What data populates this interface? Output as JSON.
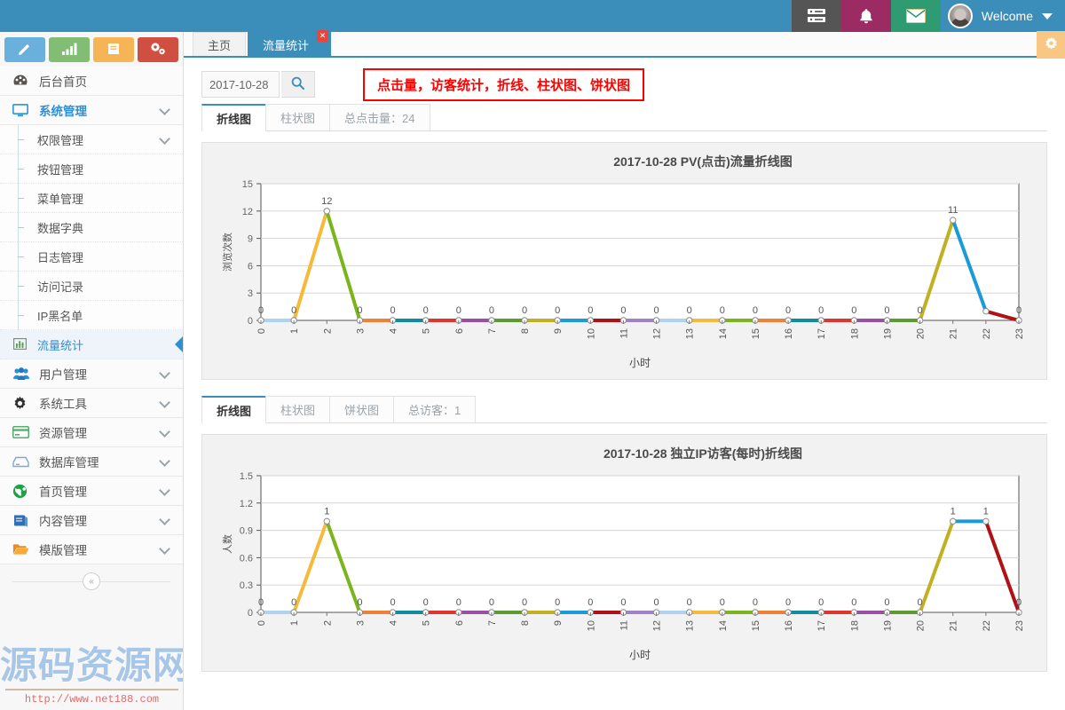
{
  "header": {
    "buttons": [
      {
        "name": "server-icon",
        "color": "#555555"
      },
      {
        "name": "bell-icon",
        "color": "#9c2a63"
      },
      {
        "name": "envelope-icon",
        "color": "#2e9b72"
      }
    ],
    "welcome_label": "Welcome",
    "bar_color": "#3b8dba"
  },
  "sidebar": {
    "quick_icons": [
      {
        "name": "pencil-icon",
        "color": "#69b0dd"
      },
      {
        "name": "bar-chart-icon",
        "color": "#82bd74"
      },
      {
        "name": "book-icon",
        "color": "#f5b556"
      },
      {
        "name": "gears-icon",
        "color": "#cf4f41"
      }
    ],
    "items": [
      {
        "label": "后台首页",
        "icon": "dashboard-icon",
        "caret": false,
        "active": false
      },
      {
        "label": "系统管理",
        "icon": "monitor-icon",
        "caret": true,
        "active": true
      },
      {
        "label": "用户管理",
        "icon": "users-icon",
        "caret": true,
        "active": false
      },
      {
        "label": "系统工具",
        "icon": "gear-icon",
        "caret": true,
        "active": false
      },
      {
        "label": "资源管理",
        "icon": "card-icon",
        "caret": true,
        "active": false
      },
      {
        "label": "数据库管理",
        "icon": "database-icon",
        "caret": true,
        "active": false
      },
      {
        "label": "首页管理",
        "icon": "globe-icon",
        "caret": true,
        "active": false
      },
      {
        "label": "内容管理",
        "icon": "book-blue-icon",
        "caret": true,
        "active": false
      },
      {
        "label": "模版管理",
        "icon": "folder-icon",
        "caret": true,
        "active": false
      }
    ],
    "submenu": [
      {
        "label": "权限管理",
        "caret": true,
        "selected": false
      },
      {
        "label": "按钮管理",
        "caret": false,
        "selected": false
      },
      {
        "label": "菜单管理",
        "caret": false,
        "selected": false
      },
      {
        "label": "数据字典",
        "caret": false,
        "selected": false
      },
      {
        "label": "日志管理",
        "caret": false,
        "selected": false
      },
      {
        "label": "访问记录",
        "caret": false,
        "selected": false
      },
      {
        "label": "IP黑名单",
        "caret": false,
        "selected": false
      },
      {
        "label": "流量统计",
        "caret": false,
        "selected": true
      }
    ],
    "collapse_icon": "«",
    "watermark_text": "源码资源网",
    "watermark_url": "http://www.net188.com"
  },
  "tabs": [
    {
      "label": "主页",
      "active": false,
      "closable": false
    },
    {
      "label": "流量统计",
      "active": true,
      "closable": true,
      "close_glyph": "✕"
    }
  ],
  "settings_gear": "gear-icon",
  "toolbar": {
    "date_value": "2017-10-28",
    "date_placeholder": "2017-10-28",
    "search_icon": "search-icon",
    "notice": "点击量，访客统计，折线、柱状图、饼状图",
    "notice_color": "#ff0000"
  },
  "panel_pv": {
    "tabs": [
      {
        "label": "折线图",
        "active": true
      },
      {
        "label": "柱状图",
        "active": false
      },
      {
        "label": "总点击量：24",
        "active": false
      }
    ]
  },
  "panel_uv": {
    "tabs": [
      {
        "label": "折线图",
        "active": true
      },
      {
        "label": "柱状图",
        "active": false
      },
      {
        "label": "饼状图",
        "active": false
      },
      {
        "label": "总访客：1",
        "active": false
      }
    ]
  },
  "chart_data": [
    {
      "type": "line",
      "title": "2017-10-28  PV(点击)流量折线图",
      "xlabel": "小时",
      "ylabel": "浏览次数",
      "categories": [
        "0",
        "1",
        "2",
        "3",
        "4",
        "5",
        "6",
        "7",
        "8",
        "9",
        "10",
        "11",
        "12",
        "13",
        "14",
        "15",
        "16",
        "17",
        "18",
        "19",
        "20",
        "21",
        "22",
        "23"
      ],
      "values": [
        0,
        0,
        12,
        0,
        0,
        0,
        0,
        0,
        0,
        0,
        0,
        0,
        0,
        0,
        0,
        0,
        0,
        0,
        0,
        0,
        0,
        11,
        1,
        0
      ],
      "point_labels": [
        "0",
        "0",
        "12",
        "0",
        "0",
        "0",
        "0",
        "0",
        "0",
        "0",
        "0",
        "0",
        "0",
        "0",
        "0",
        "0",
        "0",
        "0",
        "0",
        "0",
        "0",
        "11",
        "",
        "0"
      ],
      "ylim": [
        0,
        15
      ],
      "yticks": [
        0,
        3,
        6,
        9,
        12,
        15
      ],
      "grid": true,
      "legend": "none",
      "segment_colors": [
        "#aed3ef",
        "#f5b93c",
        "#7ab51d",
        "#ef8136",
        "#0f8ca0",
        "#e0352c",
        "#9a4fa5",
        "#5d9b30",
        "#c2b021",
        "#1a9ad6",
        "#b11016",
        "#9f82c7",
        "#aed3ef",
        "#f5b93c",
        "#7ab51d",
        "#ef8136",
        "#0f8ca0",
        "#e0352c",
        "#9a4fa5",
        "#5d9b30",
        "#c2b021",
        "#1a9ad6",
        "#b11016"
      ]
    },
    {
      "type": "line",
      "title": "2017-10-28  独立IP访客(每时)折线图",
      "xlabel": "小时",
      "ylabel": "人数",
      "categories": [
        "0",
        "1",
        "2",
        "3",
        "4",
        "5",
        "6",
        "7",
        "8",
        "9",
        "10",
        "11",
        "12",
        "13",
        "14",
        "15",
        "16",
        "17",
        "18",
        "19",
        "20",
        "21",
        "22",
        "23"
      ],
      "values": [
        0,
        0,
        1,
        0,
        0,
        0,
        0,
        0,
        0,
        0,
        0,
        0,
        0,
        0,
        0,
        0,
        0,
        0,
        0,
        0,
        0,
        1,
        1,
        0
      ],
      "point_labels": [
        "0",
        "0",
        "1",
        "0",
        "0",
        "0",
        "0",
        "0",
        "0",
        "0",
        "0",
        "0",
        "0",
        "0",
        "0",
        "0",
        "0",
        "0",
        "0",
        "0",
        "0",
        "1",
        "1",
        "0"
      ],
      "ylim": [
        0,
        1.5
      ],
      "yticks": [
        0,
        0.3,
        0.6,
        0.9,
        1.2,
        1.5
      ],
      "ytick_labels": [
        "0",
        "0.3",
        "0.6",
        "0.9",
        "1.2",
        "1.5"
      ],
      "grid": true,
      "legend": "none",
      "segment_colors": [
        "#aed3ef",
        "#f5b93c",
        "#7ab51d",
        "#ef8136",
        "#0f8ca0",
        "#e0352c",
        "#9a4fa5",
        "#5d9b30",
        "#c2b021",
        "#1a9ad6",
        "#b11016",
        "#9f82c7",
        "#aed3ef",
        "#f5b93c",
        "#7ab51d",
        "#ef8136",
        "#0f8ca0",
        "#e0352c",
        "#9a4fa5",
        "#5d9b30",
        "#c2b021",
        "#1a9ad6",
        "#b11016"
      ]
    }
  ]
}
